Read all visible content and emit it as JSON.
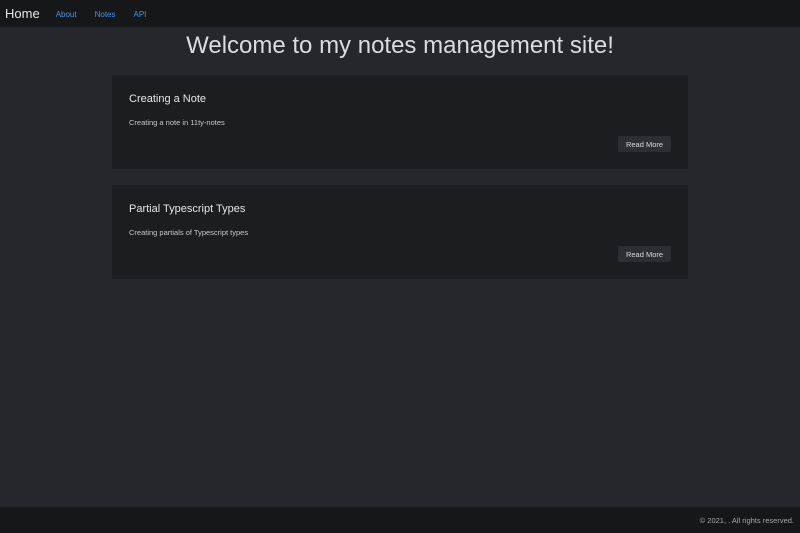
{
  "nav": {
    "brand": "Home",
    "links": [
      {
        "label": "About"
      },
      {
        "label": "Notes"
      },
      {
        "label": "API"
      }
    ]
  },
  "main": {
    "title": "Welcome to my notes management site!",
    "cards": [
      {
        "title": "Creating a Note",
        "description": "Creating a note in 11ty-notes",
        "button_label": "Read More"
      },
      {
        "title": "Partial Typescript Types",
        "description": "Creating partials of Typescript types",
        "button_label": "Read More"
      }
    ]
  },
  "footer": {
    "text": "© 2021, . All rights reserved."
  },
  "colors": {
    "page_background": "#24272c",
    "navbar_background": "#151719",
    "card_background": "#1b1d21",
    "link_accent": "#3b97f0",
    "button_background": "#2b2e33"
  }
}
